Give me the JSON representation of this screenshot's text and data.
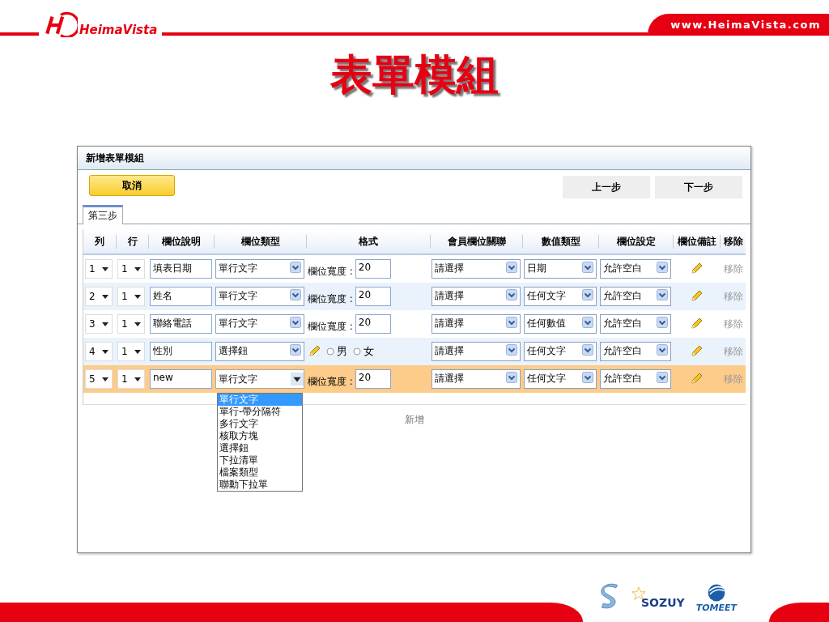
{
  "header": {
    "brand": "HeimaVista",
    "url": "www.HeimaVista.com"
  },
  "title": "表單模組",
  "window": {
    "title": "新增表單模組",
    "cancel": "取消",
    "prev": "上一步",
    "next": "下一步",
    "tabs": [
      {
        "label": "第三步",
        "selected": true
      }
    ],
    "columns": [
      "列",
      "行",
      "欄位說明",
      "欄位類型",
      "格式",
      "會員欄位關聯",
      "數值類型",
      "欄位設定",
      "欄位備註",
      "移除"
    ],
    "rows": [
      {
        "col": "1",
        "row": "1",
        "description": "填表日期",
        "type": "單行文字",
        "type_open": false,
        "format": {
          "kind": "width",
          "label": "欄位寬度 :",
          "value": "20"
        },
        "member": "請選擇",
        "value_type": "日期",
        "setting": "允許空白",
        "remove": "移除",
        "selected": false
      },
      {
        "col": "2",
        "row": "1",
        "description": "姓名",
        "type": "單行文字",
        "type_open": false,
        "format": {
          "kind": "width",
          "label": "欄位寬度 :",
          "value": "20"
        },
        "member": "請選擇",
        "value_type": "任何文字",
        "setting": "允許空白",
        "remove": "移除",
        "selected": false
      },
      {
        "col": "3",
        "row": "1",
        "description": "聯絡電話",
        "type": "單行文字",
        "type_open": false,
        "format": {
          "kind": "width",
          "label": "欄位寬度 :",
          "value": "20"
        },
        "member": "請選擇",
        "value_type": "任何數值",
        "setting": "允許空白",
        "remove": "移除",
        "selected": false
      },
      {
        "col": "4",
        "row": "1",
        "description": "性別",
        "type": "選擇鈕",
        "type_open": false,
        "format": {
          "kind": "radio",
          "options": [
            {
              "label": "男",
              "selected": false
            },
            {
              "label": "女",
              "selected": false
            }
          ]
        },
        "member": "請選擇",
        "value_type": "任何文字",
        "setting": "允許空白",
        "remove": "移除",
        "selected": false
      },
      {
        "col": "5",
        "row": "1",
        "description": "new",
        "type": "單行文字",
        "type_open": true,
        "format": {
          "kind": "width",
          "label": "欄位寬度 :",
          "value": "20"
        },
        "member": "請選擇",
        "value_type": "任何文字",
        "setting": "允許空白",
        "remove": "移除",
        "selected": true
      }
    ],
    "type_options": [
      {
        "label": "單行文字",
        "selected": true
      },
      {
        "label": "單行-帶分隔符",
        "selected": false
      },
      {
        "label": "多行文字",
        "selected": false
      },
      {
        "label": "核取方塊",
        "selected": false
      },
      {
        "label": "選擇鈕",
        "selected": false
      },
      {
        "label": "下拉清單",
        "selected": false
      },
      {
        "label": "檔案類型",
        "selected": false
      },
      {
        "label": "聯動下拉單",
        "selected": false
      }
    ],
    "add": "新增"
  },
  "footer": {
    "logos": [
      "SOZUY",
      "TOMEET"
    ]
  }
}
